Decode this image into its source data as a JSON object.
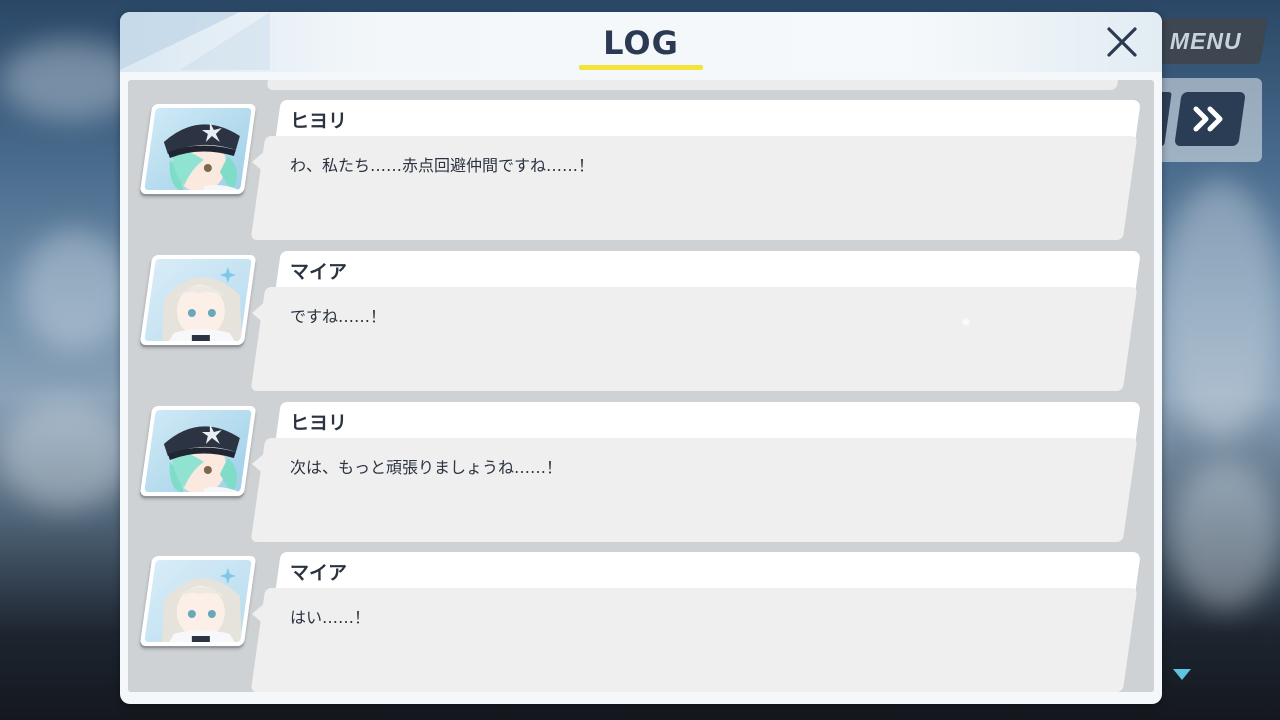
{
  "window": {
    "title": "LOG",
    "close_icon": "close-x-icon"
  },
  "hud": {
    "menu_label": "MENU",
    "fast_forward_icon": "fast-forward-icon",
    "scroll_down_icon": "triangle-down-icon"
  },
  "colors": {
    "title_underline": "#f2e43a",
    "title_text": "#2b3a52",
    "hud_button": "#2b3c55"
  },
  "log": {
    "entries": [
      {
        "speaker": "ヒヨリ",
        "text": "わ、私たち……赤点回避仲間ですね……！",
        "portrait": "hiyori-portrait"
      },
      {
        "speaker": "マイア",
        "text": "ですね……！",
        "portrait": "maia-portrait"
      },
      {
        "speaker": "ヒヨリ",
        "text": "次は、もっと頑張りましょうね……！",
        "portrait": "hiyori-portrait"
      },
      {
        "speaker": "マイア",
        "text": "はい……！",
        "portrait": "maia-portrait"
      }
    ]
  }
}
